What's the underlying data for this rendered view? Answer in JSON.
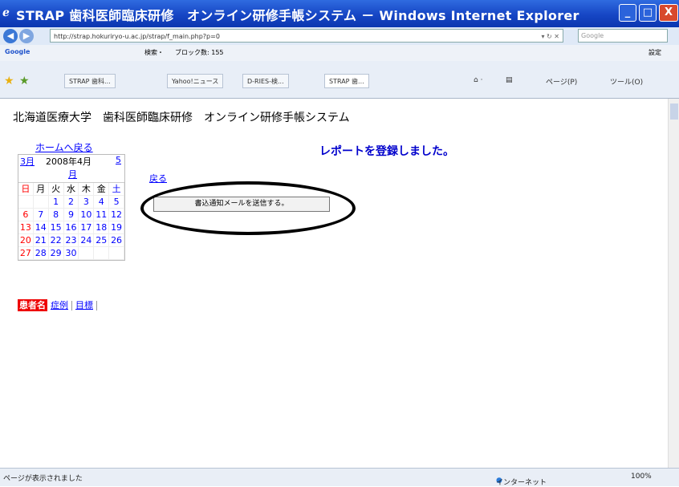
{
  "window": {
    "title": "STRAP 歯科医師臨床研修　オンライン研修手帳システム － Windows Internet Explorer",
    "min": "_",
    "max": "□",
    "close": "X"
  },
  "address": {
    "url": "http://strap.hokuriryo-u.ac.jp/strap/f_main.php?p=0",
    "search_placeholder": "Google"
  },
  "google_bar": {
    "label": "Google",
    "search": "検索・",
    "block": "ブロック数: 155",
    "settings": "設定"
  },
  "tabs": [
    "STRAP 歯科...",
    "Yahoo!ニュース",
    "D-RIES-検...",
    "STRAP 歯..."
  ],
  "commands": {
    "page": "ページ(P)",
    "tools": "ツール(O)"
  },
  "page": {
    "heading": "北海道医療大学　歯科医師臨床研修　オンライン研修手帳システム",
    "home_link": "ホームへ戻る",
    "message": "レポートを登録しました。",
    "back_link": "戻る",
    "send_button": "書込通知メールを送信する。"
  },
  "calendar": {
    "prev": "3月",
    "current": "2008年4月",
    "next": "5",
    "next2": "月",
    "weekdays": [
      "日",
      "月",
      "火",
      "水",
      "木",
      "金",
      "土"
    ],
    "rows": [
      [
        "",
        "",
        "1",
        "2",
        "3",
        "4",
        "5"
      ],
      [
        "6",
        "7",
        "8",
        "9",
        "10",
        "11",
        "12"
      ],
      [
        "13",
        "14",
        "15",
        "16",
        "17",
        "18",
        "19"
      ],
      [
        "20",
        "21",
        "22",
        "23",
        "24",
        "25",
        "26"
      ],
      [
        "27",
        "28",
        "29",
        "30",
        "",
        "",
        ""
      ]
    ]
  },
  "links": {
    "patient": "患者名",
    "symptom": "症例",
    "goal": "目標"
  },
  "status": {
    "text": "ページが表示されました",
    "zone": "インターネット",
    "zoom": "100%"
  }
}
